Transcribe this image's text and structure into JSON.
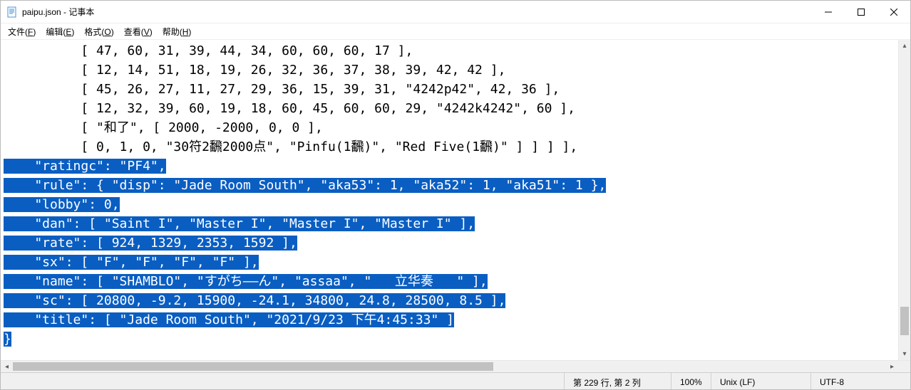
{
  "window": {
    "title": "paipu.json - 记事本"
  },
  "menu": {
    "file": "文件(F)",
    "edit": "编辑(E)",
    "format": "格式(O)",
    "view": "查看(V)",
    "help": "帮助(H)"
  },
  "content": {
    "lines": [
      "          [ 47, 60, 31, 39, 44, 34, 60, 60, 60, 17 ],",
      "          [ 12, 14, 51, 18, 19, 26, 32, 36, 37, 38, 39, 42, 42 ],",
      "          [ 45, 26, 27, 11, 27, 29, 36, 15, 39, 31, \"4242p42\", 42, 36 ],",
      "          [ 12, 32, 39, 60, 19, 18, 60, 45, 60, 60, 29, \"4242k4242\", 60 ],",
      "          [ \"和了\", [ 2000, -2000, 0, 0 ],",
      "          [ 0, 1, 0, \"30符2飜2000点\", \"Pinfu(1飜)\", \"Red Five(1飜)\" ] ] ] ],"
    ],
    "selected_lines": [
      "    \"ratingc\": \"PF4\",",
      "    \"rule\": { \"disp\": \"Jade Room South\", \"aka53\": 1, \"aka52\": 1, \"aka51\": 1 },",
      "    \"lobby\": 0,",
      "    \"dan\": [ \"Saint I\", \"Master I\", \"Master I\", \"Master I\" ],",
      "    \"rate\": [ 924, 1329, 2353, 1592 ],",
      "    \"sx\": [ \"F\", \"F\", \"F\", \"F\" ],",
      "    \"name\": [ \"SHAMBLO\", \"すがち――ん\", \"assaa\", \"   立华奏   \" ],",
      "    \"sc\": [ 20800, -9.2, 15900, -24.1, 34800, 24.8, 28500, 8.5 ],",
      "    \"title\": [ \"Jade Room South\", \"2021/9/23 下午4:45:33\" ]",
      "}"
    ]
  },
  "status": {
    "position": "第 229 行, 第 2 列",
    "zoom": "100%",
    "eol": "Unix (LF)",
    "encoding": "UTF-8"
  }
}
